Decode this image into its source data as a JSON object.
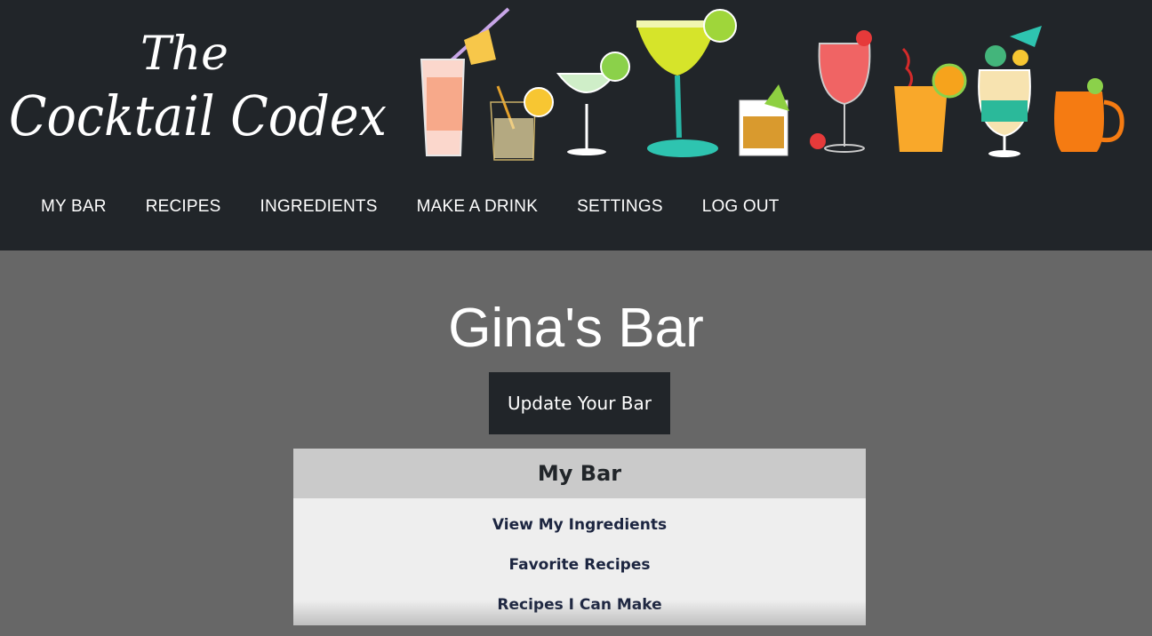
{
  "header": {
    "logo_text_line1": "The",
    "logo_text_line2": "Cocktail Codex"
  },
  "nav": {
    "items": [
      {
        "label": "MY BAR"
      },
      {
        "label": "RECIPES"
      },
      {
        "label": "INGREDIENTS"
      },
      {
        "label": "MAKE A DRINK"
      },
      {
        "label": "SETTINGS"
      },
      {
        "label": "LOG OUT"
      }
    ]
  },
  "main": {
    "title": "Gina's Bar",
    "update_button_label": "Update Your Bar",
    "panel": {
      "heading": "My Bar",
      "links": [
        {
          "label": "View My Ingredients"
        },
        {
          "label": "Favorite Recipes"
        },
        {
          "label": "Recipes I Can Make"
        }
      ]
    }
  },
  "colors": {
    "header_bg": "#212529",
    "page_bg": "#676767",
    "panel_header_bg": "#cacaca",
    "panel_bg": "#eeeeee",
    "link_color": "#1c2540"
  },
  "illustrations": [
    "highball-glass-icon",
    "rocks-glass-lemon-icon",
    "coupe-glass-lime-icon",
    "margarita-glass-icon",
    "whiskey-rocks-icon",
    "wine-glass-strawberry-icon",
    "orange-tumbler-icon",
    "hurricane-glass-umbrella-icon",
    "copper-mug-icon"
  ]
}
